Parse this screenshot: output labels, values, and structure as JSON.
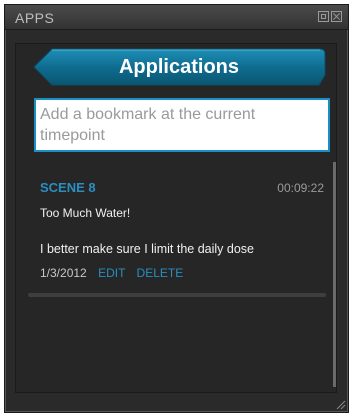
{
  "window": {
    "title": "APPS"
  },
  "header": {
    "label": "Applications"
  },
  "bookmark": {
    "placeholder": "Add a bookmark at the current timepoint"
  },
  "entries": [
    {
      "scene": "SCENE 8",
      "time": "00:09:22",
      "title": "Too Much Water!",
      "note": "I better make sure I limit the daily dose",
      "date": "1/3/2012",
      "edit_label": "EDIT",
      "delete_label": "DELETE"
    }
  ],
  "colors": {
    "accent": "#2a8fc0",
    "panel_bg": "#2a2a2a",
    "ribbon": "#0f6a8c"
  }
}
